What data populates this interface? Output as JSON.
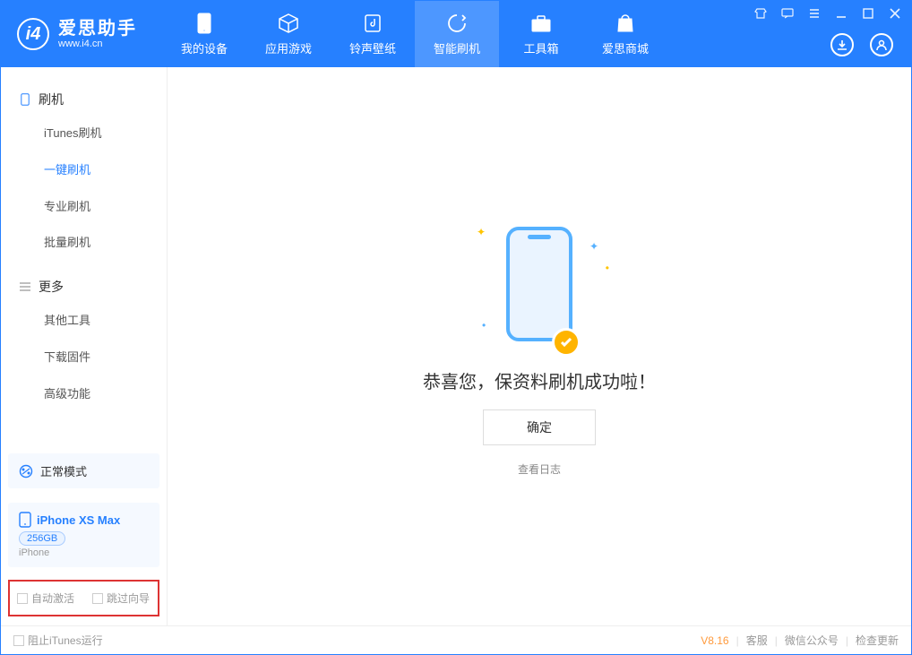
{
  "logo": {
    "title": "爱思助手",
    "sub": "www.i4.cn"
  },
  "tabs": {
    "device": "我的设备",
    "apps": "应用游戏",
    "ringtone": "铃声壁纸",
    "flash": "智能刷机",
    "toolbox": "工具箱",
    "store": "爱思商城"
  },
  "sidebar": {
    "section_flash": "刷机",
    "itunes_flash": "iTunes刷机",
    "easy_flash": "一键刷机",
    "pro_flash": "专业刷机",
    "batch_flash": "批量刷机",
    "section_more": "更多",
    "other_tools": "其他工具",
    "download_fw": "下载固件",
    "advanced": "高级功能"
  },
  "device": {
    "mode": "正常模式",
    "name": "iPhone XS Max",
    "capacity": "256GB",
    "type": "iPhone"
  },
  "options": {
    "auto_activate": "自动激活",
    "skip_guide": "跳过向导"
  },
  "main": {
    "success": "恭喜您，保资料刷机成功啦！",
    "ok": "确定",
    "view_log": "查看日志"
  },
  "footer": {
    "block_itunes": "阻止iTunes运行",
    "version": "V8.16",
    "support": "客服",
    "wechat": "微信公众号",
    "check_update": "检查更新"
  }
}
